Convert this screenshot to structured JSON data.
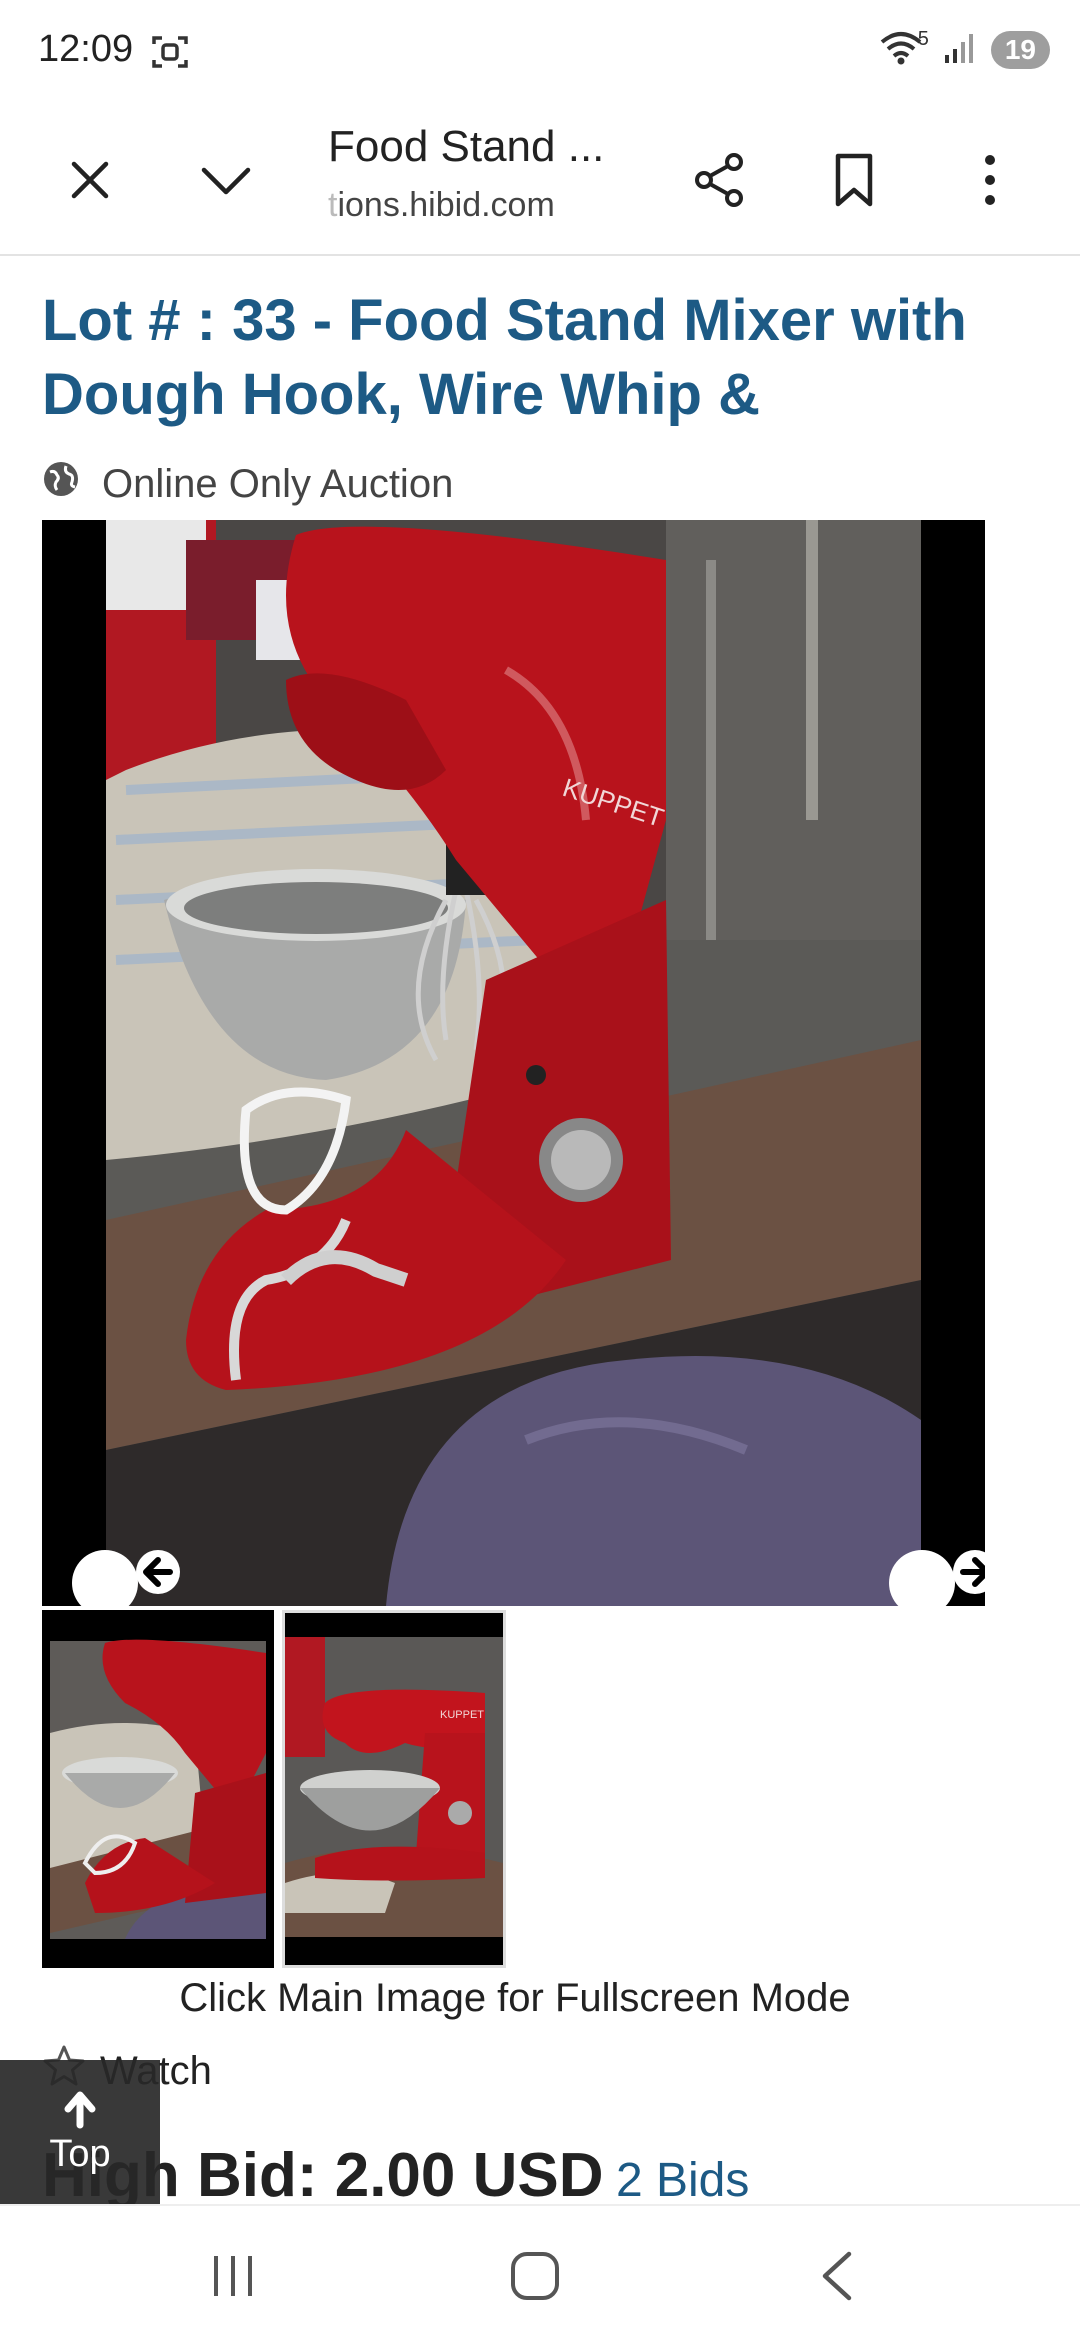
{
  "status": {
    "time": "12:09",
    "network": "5",
    "battery": "19"
  },
  "toolbar": {
    "page_title": "Food Stand ...",
    "url_faded": "t",
    "url": "ions.hibid.com"
  },
  "lot": {
    "title": "Lot # : 33 - Food Stand Mixer with Dough Hook, Wire Whip &",
    "auction_type": "Online Only Auction",
    "image_brand": "KUPPET",
    "thumb_brand": "KUPPET",
    "caption": "Click Main Image for Fullscreen Mode",
    "watch_label": "Watch",
    "high_bid_label": "High Bid: 2.00 USD",
    "bids_link": "2 Bids"
  },
  "top_button": {
    "label": "Top"
  },
  "colors": {
    "title_blue": "#1d5a85",
    "mixer_red": "#c0141e",
    "image_bg": "#000000"
  }
}
